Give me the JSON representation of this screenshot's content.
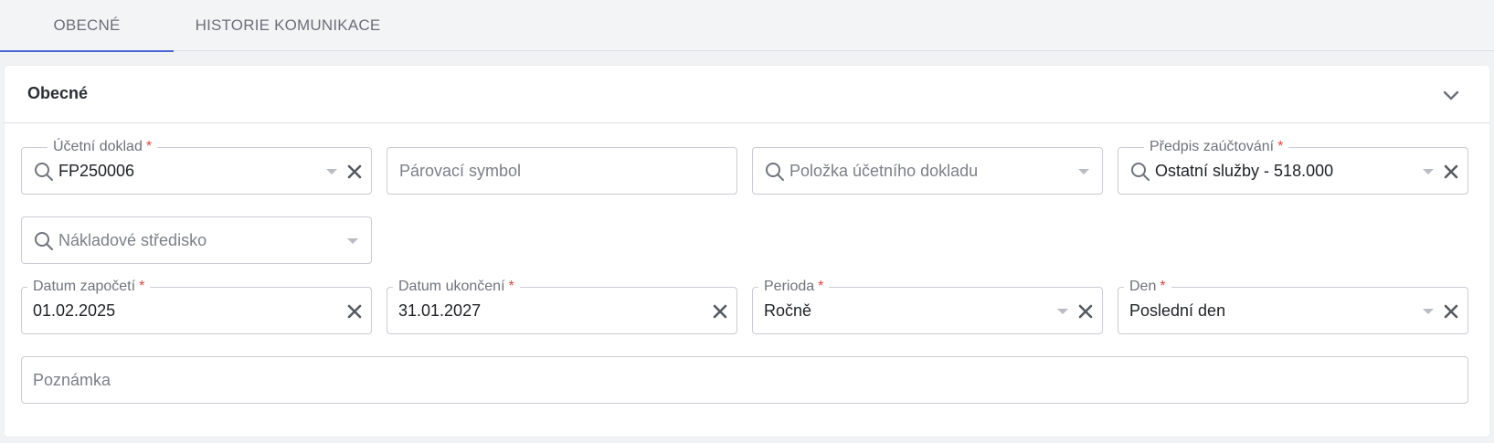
{
  "tabs": [
    {
      "label": "OBECNÉ"
    },
    {
      "label": "HISTORIE KOMUNIKACE"
    }
  ],
  "section": {
    "title": "Obecné"
  },
  "fields": {
    "ucetni_doklad": {
      "label": "Účetní doklad",
      "required": "*",
      "value": "FP250006"
    },
    "parovaci_symbol": {
      "placeholder": "Párovací symbol"
    },
    "polozka": {
      "placeholder": "Položka účetního dokladu"
    },
    "predpis": {
      "label": "Předpis zaúčtování",
      "required": "*",
      "value": "Ostatní služby - 518.000"
    },
    "stredisko": {
      "placeholder": "Nákladové středisko"
    },
    "datum_zapoceti": {
      "label": "Datum započetí",
      "required": "*",
      "value": "01.02.2025"
    },
    "datum_ukonceni": {
      "label": "Datum ukončení",
      "required": "*",
      "value": "31.01.2027"
    },
    "perioda": {
      "label": "Perioda",
      "required": "*",
      "value": "Ročně"
    },
    "den": {
      "label": "Den",
      "required": "*",
      "value": "Poslední den"
    },
    "poznamka": {
      "placeholder": "Poznámka"
    }
  },
  "colors": {
    "accent": "#4a67d6",
    "required": "#e0453e"
  }
}
